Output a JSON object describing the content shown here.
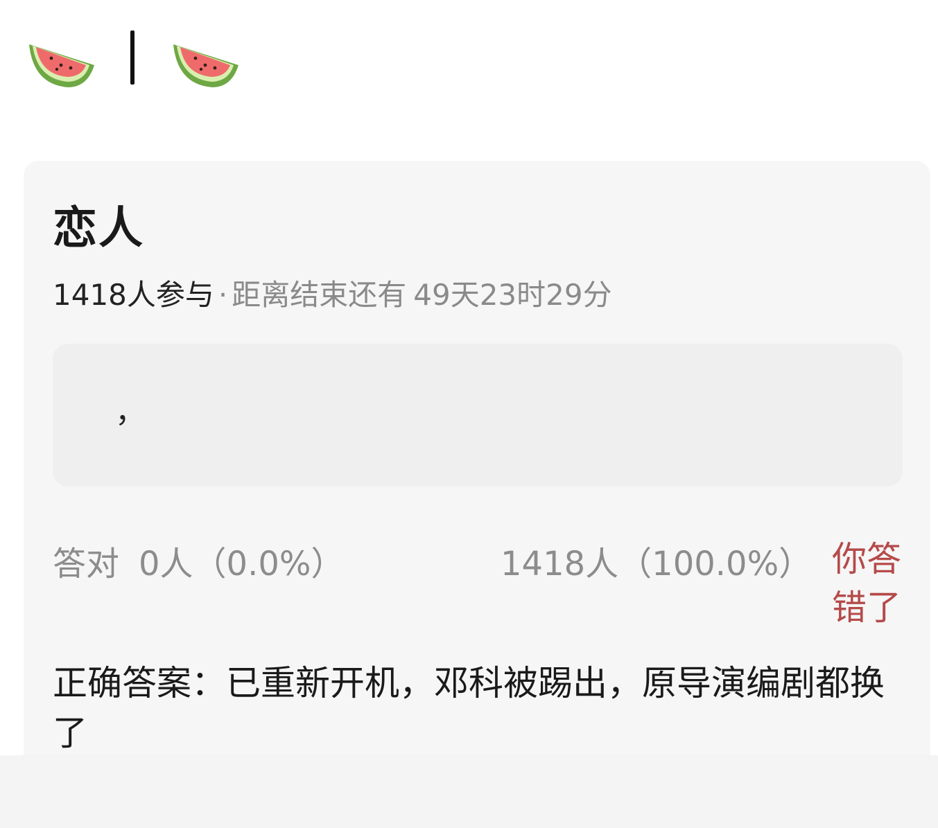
{
  "header": {
    "icons": [
      "watermelon-icon",
      "watermelon-icon"
    ],
    "separator": "|"
  },
  "poll": {
    "title": "恋人",
    "participants": "1418人参与",
    "separator_dot": "·",
    "deadline_label": "距离结束还有",
    "deadline_value": "49天23时29分",
    "option_text": "，",
    "correct_label": "答对",
    "correct_count": "0人（0.0%）",
    "wrong_count": "1418人（100.0%）",
    "result_text": "你答错了",
    "answer_text": "正确答案：已重新开机，邓科被踢出，原导演编剧都换了"
  },
  "colors": {
    "background": "#ffffff",
    "card": "#f6f6f6",
    "option_box": "#efefef",
    "muted_text": "#8c8c8c",
    "wrong_red": "#b54a4a"
  }
}
